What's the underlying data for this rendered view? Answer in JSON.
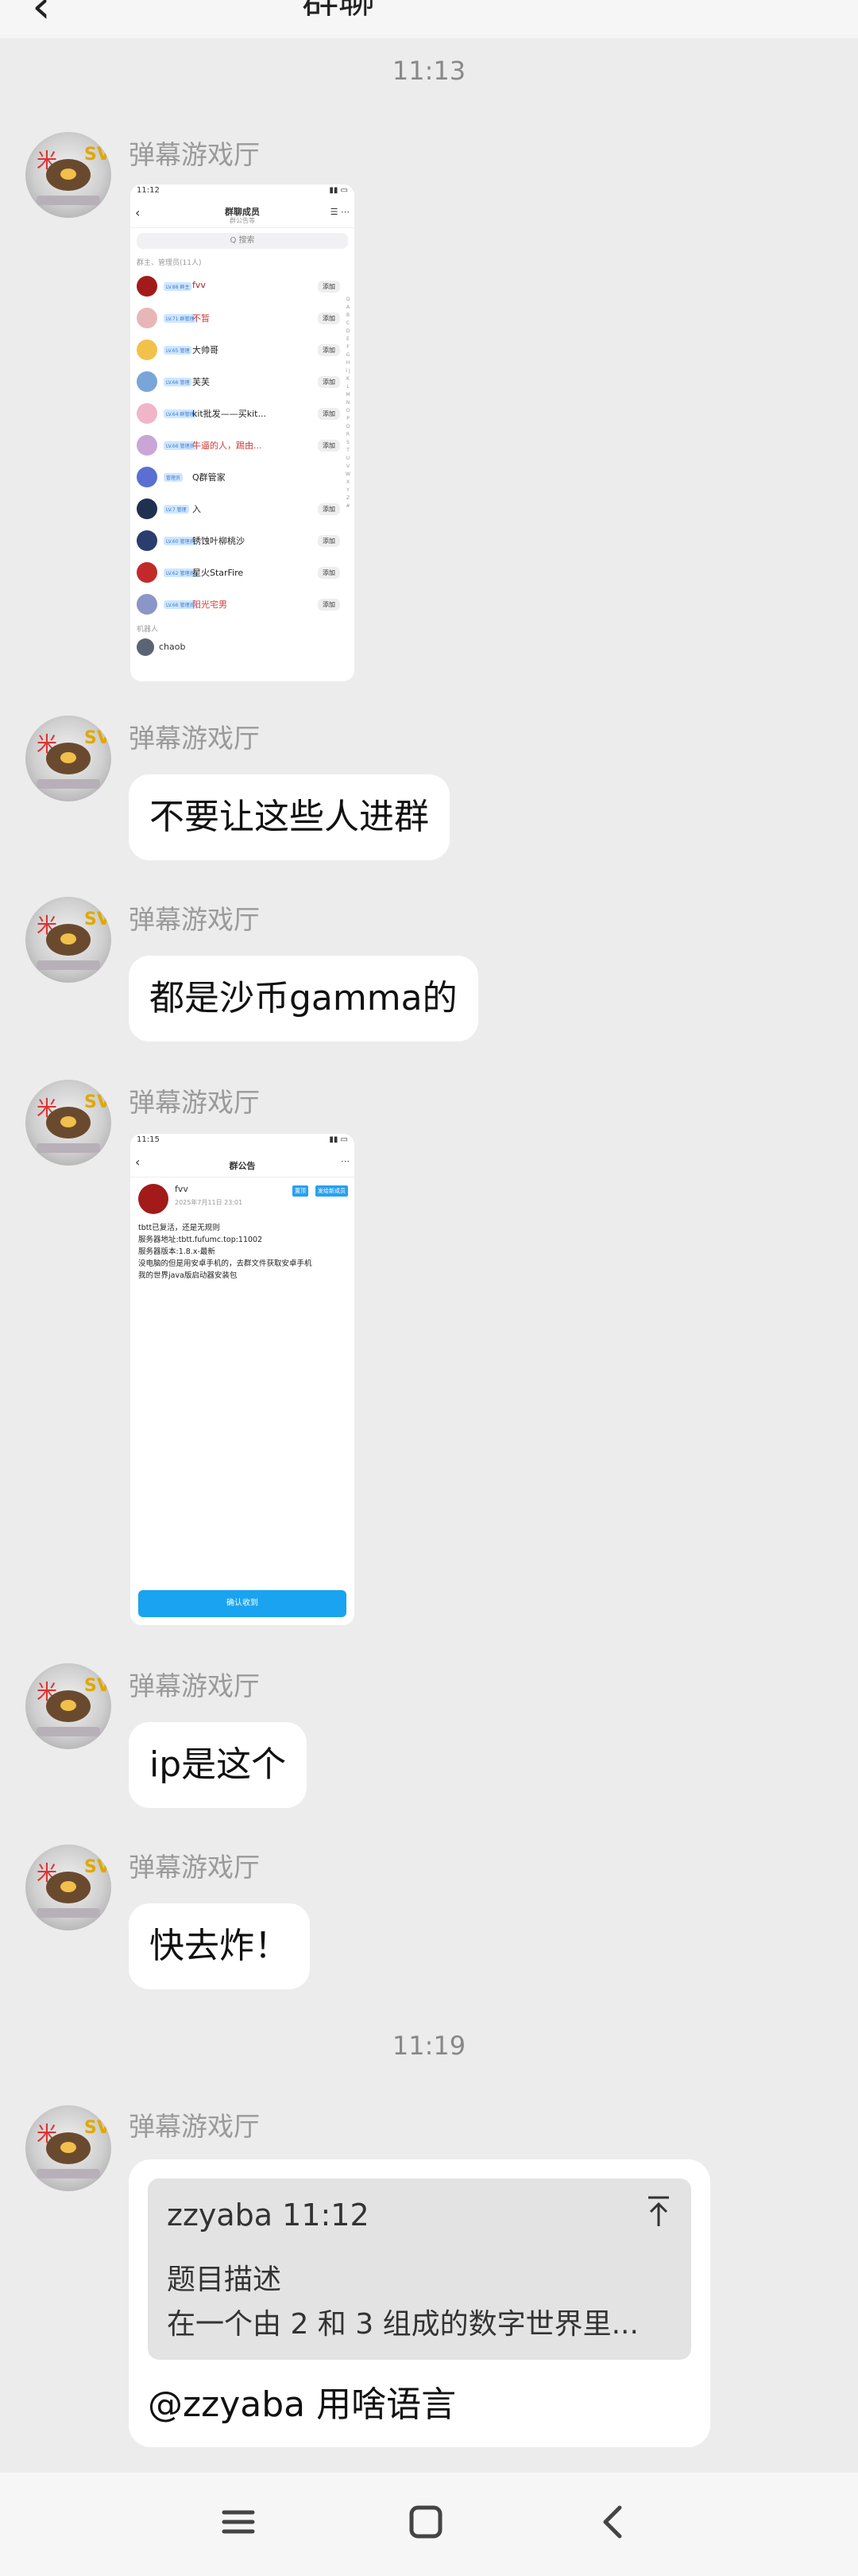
{
  "header": {
    "back_icon": "back-chevron-icon",
    "title": "群聊",
    "more_icon": "more-icon"
  },
  "times": [
    "11:13",
    "11:19"
  ],
  "sender": "弹幕游戏厅",
  "messages": {
    "m1_image": {
      "status_time": "11:12",
      "title": "群聊成员",
      "subtitle": "群公告等",
      "search": "Q 搜索",
      "section": "群主、管理员(11人)",
      "members": [
        {
          "tag": "LV.88 群主",
          "name": "fvv",
          "color": "#b01d1d",
          "avc": "#a31a1a"
        },
        {
          "tag": "LV.71 群管理",
          "name": "不暂",
          "color": "#d43b3b",
          "avc": "#e7b7b7"
        },
        {
          "tag": "LV.65 管理",
          "name": "大帅哥",
          "color": "#222222",
          "avc": "#f2c14a"
        },
        {
          "tag": "LV.66 管理",
          "name": "芙芙",
          "color": "#222222",
          "avc": "#7aa5d8"
        },
        {
          "tag": "LV.64 群管理",
          "name": "kit批发——买kit...",
          "color": "#222222",
          "avc": "#f0b6c8"
        },
        {
          "tag": "LV.66 管理员",
          "name": "牛逼的人，踢由...",
          "color": "#d43b3b",
          "avc": "#c9a6d6"
        },
        {
          "tag": "管理员",
          "name": "Q群管家",
          "color": "#222222",
          "avc": "#5a6fd1"
        },
        {
          "tag": "LV.7 管理",
          "name": "入",
          "color": "#222222",
          "avc": "#203050"
        },
        {
          "tag": "LV.60 管理员",
          "name": "锈蚀叶柳桃沙",
          "color": "#222222",
          "avc": "#2a3d6e"
        },
        {
          "tag": "LV.62 管理员",
          "name": "星火StarFire",
          "color": "#222222",
          "avc": "#c22a2a"
        },
        {
          "tag": "LV.66 管理员",
          "name": "阳光宅男",
          "color": "#d43b3b",
          "avc": "#8a96c8"
        }
      ],
      "add_label": "添加",
      "robots": "机器人",
      "robot_name": "chaob",
      "index_letters": "Q A B C D E F G H I J K L M N O P Q R S T U V W X Y Z #"
    },
    "m2_text": "不要让这些人进群",
    "m3_text": "都是沙币gamma的",
    "m4_image": {
      "status_time": "11:15",
      "title": "群公告",
      "author": "fvv",
      "date": "2025年7月11日 23:01",
      "badge1": "置顶",
      "badge2": "发给新成员",
      "body": "tbtt已复活，还是无规则\n服务器地址:tbtt.fufumc.top:11002\n服务器版本:1.8.x-最新\n没电脑的但是用安卓手机的，去群文件获取安卓手机\n我的世界java版启动器安装包",
      "confirm": "确认收到"
    },
    "m5_text": "ip是这个",
    "m6_text": "快去炸！",
    "m7_reply": {
      "quote_author": "zzyaba 11:12",
      "quote_line1": "题目描述",
      "quote_line2": "在一个由 2 和 3 组成的数字世界里...",
      "text": "@zzyaba 用啥语言"
    }
  },
  "navbar": {
    "menu_icon": "menu-icon",
    "home_icon": "home-square-icon",
    "back_icon": "back-triangle-icon"
  }
}
